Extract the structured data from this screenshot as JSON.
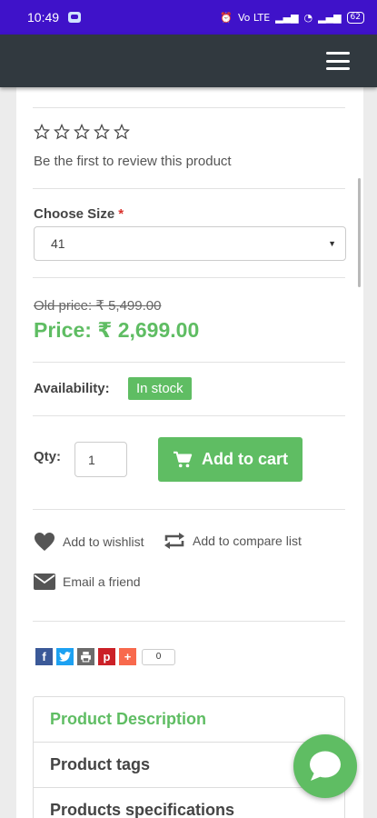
{
  "status_bar": {
    "time": "10:49",
    "network_text": "Vo LTE",
    "battery": "62"
  },
  "rating": {
    "stars": 0,
    "max": 5,
    "review_text": "Be the first to review this product"
  },
  "size": {
    "label": "Choose Size",
    "required_mark": "*",
    "selected": "41"
  },
  "prices": {
    "old": "Old price: ₹ 5,499.00",
    "current": "Price: ₹ 2,699.00"
  },
  "availability": {
    "label": "Availability:",
    "status": "In stock"
  },
  "quantity": {
    "label": "Qty:",
    "value": "1"
  },
  "cart": {
    "button_label": "Add to cart"
  },
  "links": {
    "wishlist": "Add to wishlist",
    "compare": "Add to compare list",
    "email": "Email a friend"
  },
  "share": {
    "count": "0"
  },
  "tabs": [
    {
      "label": "Product Description"
    },
    {
      "label": "Product tags"
    },
    {
      "label": "Products specifications"
    }
  ],
  "colors": {
    "accent_green": "#5fbd63",
    "header": "#31393f",
    "status_bar": "#3f12c9"
  },
  "icons": [
    "menu-icon",
    "star-outline-icon",
    "cart-icon",
    "heart-icon",
    "compare-arrows-icon",
    "envelope-icon",
    "facebook-icon",
    "twitter-icon",
    "print-icon",
    "pinterest-icon",
    "addthis-icon",
    "chat-bubble-icon"
  ]
}
